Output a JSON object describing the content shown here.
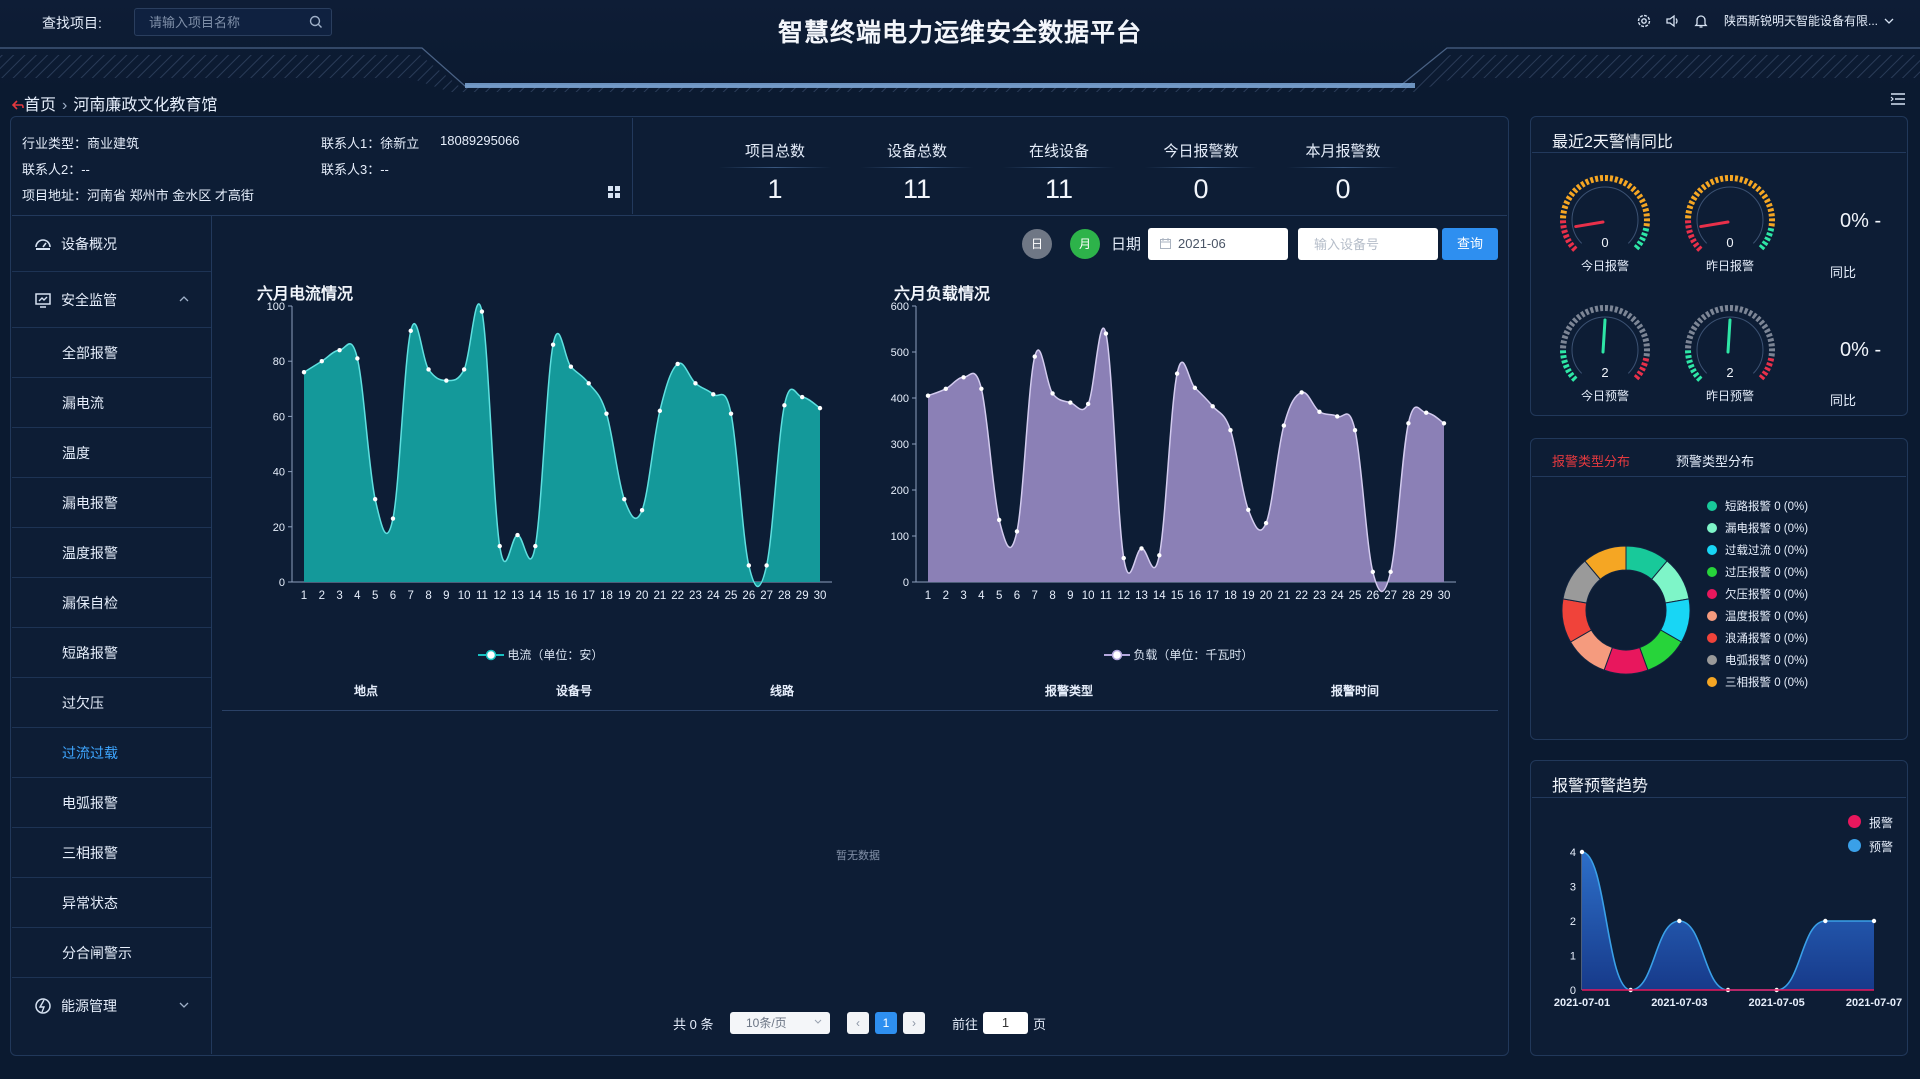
{
  "header": {
    "search_label": "查找项目:",
    "search_placeholder": "请输入项目名称",
    "title": "智慧终端电力运维安全数据平台",
    "company": "陕西斯锐明天智能设备有限..."
  },
  "breadcrumb": {
    "home": "首页",
    "current": "河南廉政文化教育馆"
  },
  "project_info": {
    "industry": "行业类型：商业建筑",
    "contact1": "联系人1：徐新立",
    "phone1": "18089295066",
    "contact2": "联系人2：--",
    "contact3": "联系人3：--",
    "address": "项目地址：河南省 郑州市 金水区 才高街"
  },
  "stats": [
    {
      "label": "项目总数",
      "value": "1"
    },
    {
      "label": "设备总数",
      "value": "11"
    },
    {
      "label": "在线设备",
      "value": "11"
    },
    {
      "label": "今日报警数",
      "value": "0"
    },
    {
      "label": "本月报警数",
      "value": "0"
    }
  ],
  "sidebar": {
    "top1": "设备概况",
    "top2": "安全监管",
    "items": [
      "全部报警",
      "漏电流",
      "温度",
      "漏电报警",
      "温度报警",
      "漏保自检",
      "短路报警",
      "过欠压",
      "过流过载",
      "电弧报警",
      "三相报警",
      "异常状态",
      "分合闸警示"
    ],
    "active_item": "过流过载",
    "top3": "能源管理"
  },
  "controls": {
    "day_btn": "日",
    "month_btn": "月",
    "date_label": "日期",
    "date_value": "2021-06",
    "device_placeholder": "输入设备号",
    "query_btn": "查询",
    "day_color": "#6f7785",
    "month_color": "#2db34a",
    "query_color": "#2e8ff0"
  },
  "chart_data": [
    {
      "type": "area",
      "title": "六月电流情况",
      "series_name": "电流（单位：安）",
      "x": [
        1,
        2,
        3,
        4,
        5,
        6,
        7,
        8,
        9,
        10,
        11,
        12,
        13,
        14,
        15,
        16,
        17,
        18,
        19,
        20,
        21,
        22,
        23,
        24,
        25,
        26,
        27,
        28,
        29,
        30
      ],
      "values": [
        76,
        80,
        84,
        81,
        30,
        23,
        91,
        77,
        73,
        77,
        98,
        13,
        17,
        13,
        86,
        78,
        72,
        61,
        30,
        26,
        62,
        79,
        72,
        68,
        61,
        6,
        6,
        64,
        67,
        63
      ],
      "ylim": [
        0,
        100
      ],
      "yticks": [
        0,
        20,
        40,
        60,
        80,
        100
      ],
      "color": "#17a3a3"
    },
    {
      "type": "area",
      "title": "六月负载情况",
      "series_name": "负载（单位：千瓦时）",
      "x": [
        1,
        2,
        3,
        4,
        5,
        6,
        7,
        8,
        9,
        10,
        11,
        12,
        13,
        14,
        15,
        16,
        17,
        18,
        19,
        20,
        21,
        22,
        23,
        24,
        25,
        26,
        27,
        28,
        29,
        30
      ],
      "values": [
        405,
        420,
        445,
        420,
        135,
        110,
        490,
        410,
        390,
        387,
        540,
        52,
        73,
        58,
        453,
        422,
        382,
        330,
        157,
        128,
        340,
        412,
        370,
        360,
        330,
        22,
        22,
        345,
        368,
        345
      ],
      "ylim": [
        0,
        600
      ],
      "yticks": [
        0,
        100,
        200,
        300,
        400,
        500,
        600
      ],
      "color": "#9a8cc6"
    },
    {
      "type": "area",
      "title": "报警预警趋势",
      "x": [
        "2021-07-01",
        "2021-07-02",
        "2021-07-03",
        "2021-07-04",
        "2021-07-05",
        "2021-07-06",
        "2021-07-07"
      ],
      "x_tick_labels": [
        "2021-07-01",
        "2021-07-03",
        "2021-07-05",
        "2021-07-07"
      ],
      "series": [
        {
          "name": "报警",
          "values": [
            0,
            0,
            0,
            0,
            0,
            0,
            0
          ],
          "color": "#e8175d"
        },
        {
          "name": "预警",
          "values": [
            4,
            0,
            2,
            0,
            0,
            2,
            2
          ],
          "color": "#3aa0e8"
        }
      ],
      "ylim": [
        0,
        4
      ],
      "yticks": [
        0,
        1,
        2,
        3,
        4
      ]
    },
    {
      "type": "pie",
      "title": "报警类型分布",
      "labels": [
        "短路报警 0 (0%)",
        "漏电报警 0 (0%)",
        "过载过流 0 (0%)",
        "过压报警 0 (0%)",
        "欠压报警 0 (0%)",
        "温度报警 0 (0%)",
        "浪涌报警 0 (0%)",
        "电弧报警 0 (0%)",
        "三相报警 0 (0%)"
      ],
      "values": [
        0,
        0,
        0,
        0,
        0,
        0,
        0,
        0,
        0
      ],
      "colors": [
        "#18c99a",
        "#7ef5c8",
        "#18d6f5",
        "#27d43a",
        "#e8175d",
        "#f59b7e",
        "#f0433a",
        "#9a9a9a",
        "#f5a623"
      ]
    }
  ],
  "table": {
    "headers": [
      "地点",
      "设备号",
      "线路",
      "报警类型",
      "报警时间"
    ],
    "empty_text": "暂无数据"
  },
  "pager": {
    "total": "共 0 条",
    "per_page": "10条/页",
    "current": "1",
    "goto_label": "前往",
    "goto_value": "1",
    "page_suffix": "页"
  },
  "alarm_compare": {
    "title": "最近2天警情同比",
    "today_alarm_value": "0",
    "today_alarm_label": "今日报警",
    "yesterday_alarm_value": "0",
    "yesterday_alarm_label": "昨日报警",
    "today_warn_value": "2",
    "today_warn_label": "今日预警",
    "yesterday_warn_value": "2",
    "yesterday_warn_label": "昨日预警",
    "pct1": "0% -",
    "pct2": "0% -",
    "yoy1": "同比",
    "yoy2": "同比"
  },
  "distribution": {
    "tab_alarm": "报警类型分布",
    "tab_warn": "预警类型分布"
  },
  "trend": {
    "title": "报警预警趋势"
  }
}
